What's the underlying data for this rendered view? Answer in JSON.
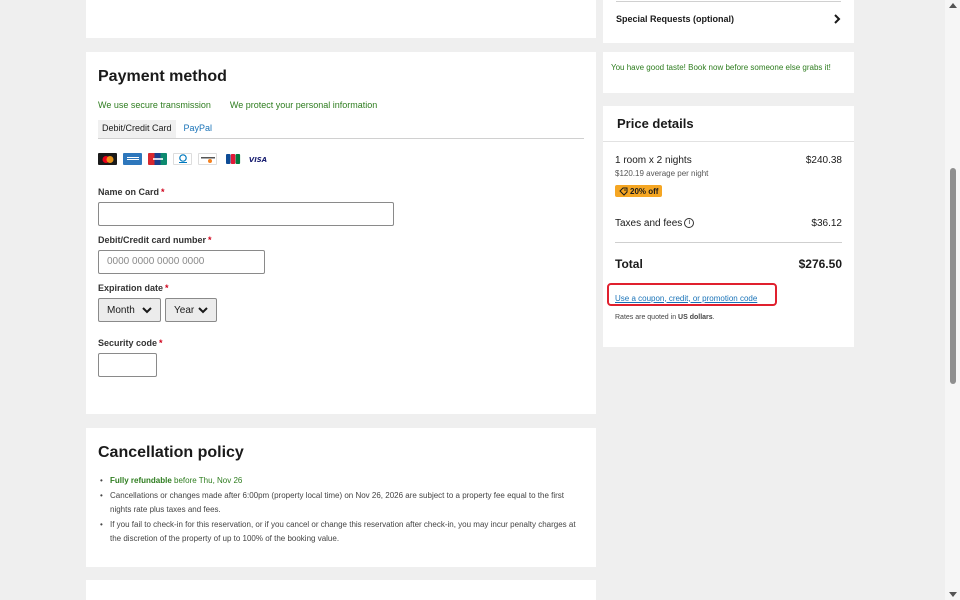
{
  "payment": {
    "title": "Payment method",
    "secure_transmission": "We use secure transmission",
    "protect_info": "We protect your personal information",
    "tabs": [
      "Debit/Credit Card",
      "PayPal"
    ],
    "card_brands": [
      "mastercard-icon",
      "amex-icon",
      "unionpay-icon",
      "diners-icon",
      "discover-icon",
      "jcb-icon",
      "visa-icon"
    ],
    "name_label": "Name on Card",
    "name_value": "",
    "number_label": "Debit/Credit card number",
    "number_placeholder": "0000 0000 0000 0000",
    "expiration_label": "Expiration date",
    "month_value": "Month",
    "year_value": "Year",
    "security_label": "Security code",
    "required_mark": "*"
  },
  "cancellation": {
    "title": "Cancellation policy",
    "refundable": "Fully refundable",
    "refundable_rest": " before Thu, Nov 26",
    "item2": "Cancellations or changes made after 6:00pm (property local time) on Nov 26, 2026 are subject to a property fee equal to the first nights rate plus taxes and fees.",
    "item3": "If you fail to check-in for this reservation, or if you cancel or change this reservation after check-in, you may incur penalty charges at the discretion of the property of up to 100% of the booking value."
  },
  "sidebar": {
    "special_requests": "Special Requests (optional)",
    "taste_message": "You have good taste! Book now before someone else grabs it!"
  },
  "price": {
    "title": "Price details",
    "room_line": "1 room x 2 nights",
    "room_amount": "$240.38",
    "average": "$120.19 average per night",
    "discount": "20% off",
    "taxes_label": "Taxes and fees",
    "taxes_amount": "$36.12",
    "total_label": "Total",
    "total_amount": "$276.50",
    "coupon_link": "Use a coupon, credit, or promotion code",
    "rates_prefix": "Rates are quoted in ",
    "rates_currency": "US dollars",
    "rates_suffix": "."
  },
  "colors": {
    "green": "#2e7d1f",
    "link": "#1a73b8",
    "badge": "#f5a623",
    "highlight": "#e0202e"
  }
}
